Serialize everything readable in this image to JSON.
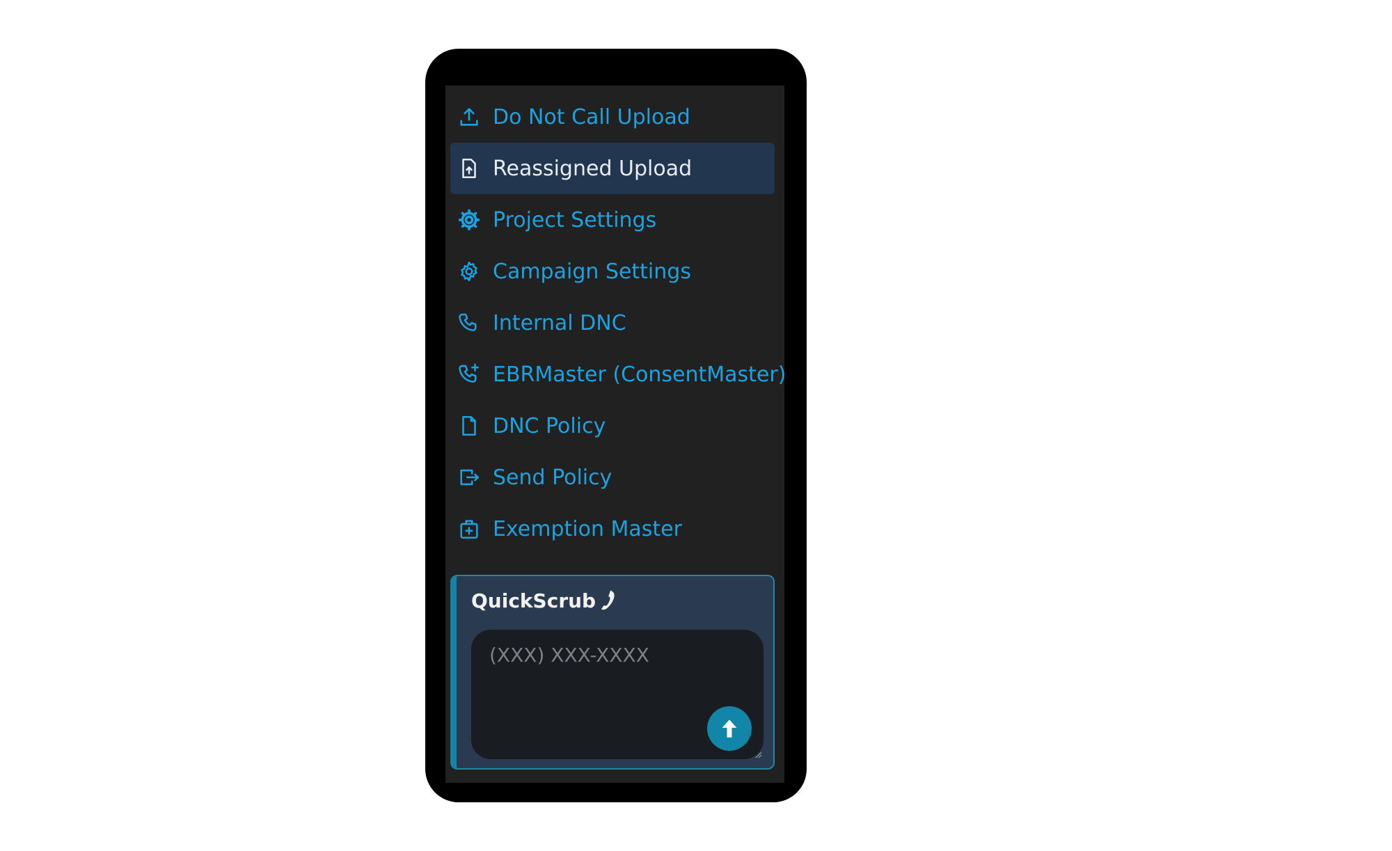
{
  "menu": {
    "items": [
      {
        "label": "Do Not Call Upload",
        "icon": "upload-icon",
        "active": false
      },
      {
        "label": "Reassigned Upload",
        "icon": "file-upload-icon",
        "active": true
      },
      {
        "label": "Project Settings",
        "icon": "gear-filled-icon",
        "active": false
      },
      {
        "label": "Campaign Settings",
        "icon": "gear-icon",
        "active": false
      },
      {
        "label": "Internal DNC",
        "icon": "phone-icon",
        "active": false
      },
      {
        "label": "EBRMaster (ConsentMaster)",
        "icon": "phone-plus-icon",
        "active": false
      },
      {
        "label": "DNC Policy",
        "icon": "file-icon",
        "active": false
      },
      {
        "label": "Send Policy",
        "icon": "send-out-icon",
        "active": false
      },
      {
        "label": "Exemption Master",
        "icon": "medical-bag-icon",
        "active": false
      }
    ]
  },
  "quickscrub": {
    "title": "QuickScrub",
    "title_icon": "phone-handset-icon",
    "input_placeholder": "(XXX) XXX-XXXX",
    "input_value": "",
    "submit_icon": "arrow-up-icon"
  },
  "colors": {
    "link": "#1ea1df",
    "active_bg": "#233650",
    "panel_bg": "#212121",
    "accent": "#1385a8"
  }
}
